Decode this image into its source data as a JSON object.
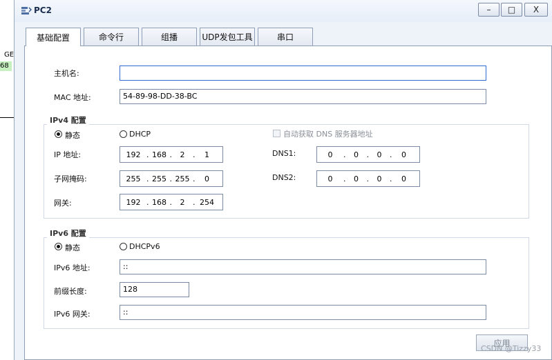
{
  "background": {
    "label1": "GE",
    "label2": "68"
  },
  "window": {
    "title": "PC2"
  },
  "tabs": [
    "基础配置",
    "命令行",
    "组播",
    "UDP发包工具",
    "串口"
  ],
  "basic": {
    "hostname_label": "主机名:",
    "hostname_value": "",
    "mac_label": "MAC 地址:",
    "mac_value": "54-89-98-DD-38-BC"
  },
  "ipv4": {
    "group_title": "IPv4 配置",
    "static_label": "静态",
    "dhcp_label": "DHCP",
    "auto_dns_label": "自动获取 DNS 服务器地址",
    "ip_label": "IP 地址:",
    "ip": [
      "192",
      "168",
      "2",
      "1"
    ],
    "mask_label": "子网掩码:",
    "mask": [
      "255",
      "255",
      "255",
      "0"
    ],
    "gateway_label": "网关:",
    "gateway": [
      "192",
      "168",
      "2",
      "254"
    ],
    "dns1_label": "DNS1:",
    "dns1": [
      "0",
      "0",
      "0",
      "0"
    ],
    "dns2_label": "DNS2:",
    "dns2": [
      "0",
      "0",
      "0",
      "0"
    ]
  },
  "ipv6": {
    "group_title": "IPv6 配置",
    "static_label": "静态",
    "dhcp_label": "DHCPv6",
    "ip_label": "IPv6 地址:",
    "ip_value": "::",
    "prefix_label": "前缀长度:",
    "prefix_value": "128",
    "gateway_label": "IPv6 网关:",
    "gateway_value": "::"
  },
  "apply_label": "应用",
  "watermark": "CSDN @Tizzy33",
  "colors": {
    "window_bg": "#eef3fa",
    "border": "#8d9db6",
    "focus": "#2f6ad0"
  }
}
